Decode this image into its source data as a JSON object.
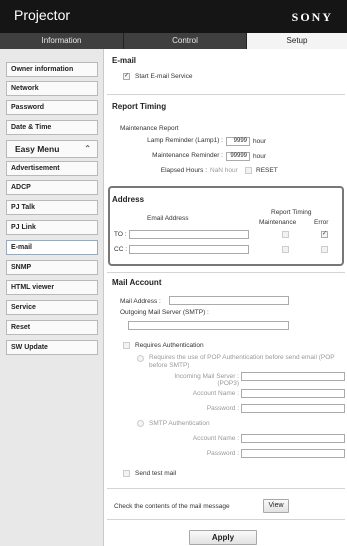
{
  "header": {
    "title": "Projector",
    "brand": "SONY"
  },
  "tabs": [
    {
      "label": "Information"
    },
    {
      "label": "Control"
    },
    {
      "label": "Setup"
    }
  ],
  "sidebar": {
    "items_top": [
      "Owner information",
      "Network",
      "Password",
      "Date & Time"
    ],
    "group_label": "Easy Menu",
    "items_bottom": [
      "Advertisement",
      "ADCP",
      "PJ Talk",
      "PJ Link",
      "E-mail",
      "SNMP",
      "HTML viewer",
      "Service",
      "Reset",
      "SW Update"
    ],
    "active": "E-mail"
  },
  "email": {
    "section_title": "E-mail",
    "start_service_label": "Start E-mail Service",
    "start_service_checked": true
  },
  "report_timing": {
    "section_title": "Report Timing",
    "maintenance_report_label": "Maintenance Report",
    "lamp_reminder_label": "Lamp Reminder (Lamp1) :",
    "lamp_reminder_value": "9999",
    "lamp_unit": "hour",
    "maintenance_reminder_label": "Maintenance Reminder :",
    "maintenance_reminder_value": "99999",
    "maintenance_unit": "hour",
    "elapsed_label": "Elapsed Hours :",
    "elapsed_value": "NaN hour",
    "reset_label": "RESET"
  },
  "address": {
    "section_title": "Address",
    "email_col": "Email Address",
    "report_timing_col": "Report Timing",
    "maintenance_col": "Maintenance",
    "error_col": "Error",
    "rows": [
      {
        "label": "TO :",
        "value": "",
        "maintenance": false,
        "error": true
      },
      {
        "label": "CC :",
        "value": "",
        "maintenance": false,
        "error": false
      }
    ]
  },
  "mail_account": {
    "section_title": "Mail Account",
    "mail_address_label": "Mail Address :",
    "mail_address_value": "",
    "smtp_label": "Outgoing Mail Server (SMTP) :",
    "smtp_value": "",
    "requires_auth_label": "Requires Authentication",
    "pop_option_label": "Requires the use of POP Authentication before send email (POP before SMTP)",
    "incoming_label": "Incoming Mail Server :",
    "incoming_sub": "(POP3)",
    "account_name_label": "Account Name :",
    "password_label": "Password :",
    "smtp_auth_label": "SMTP Authentication",
    "account_name2_label": "Account Name :",
    "password2_label": "Password :",
    "send_test_label": "Send test mail"
  },
  "check": {
    "label": "Check the contents of the mail message",
    "view_button": "View"
  },
  "apply_button": "Apply"
}
